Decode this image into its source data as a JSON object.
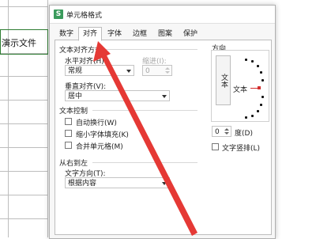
{
  "spreadsheet": {
    "cell_text": "演示文件"
  },
  "dialog": {
    "title": "单元格格式",
    "app_icon_letter": "S",
    "tabs": [
      "数字",
      "对齐",
      "字体",
      "边框",
      "图案",
      "保护"
    ],
    "active_tab": "对齐",
    "alignment": {
      "section_title": "文本对齐方式",
      "horizontal_label": "水平对齐(H):",
      "horizontal_value": "常规",
      "indent_label": "缩进(I):",
      "indent_value": "0",
      "vertical_label": "垂直对齐(V):",
      "vertical_value": "居中"
    },
    "text_control": {
      "section_title": "文本控制",
      "options": [
        {
          "label": "自动换行(W)",
          "checked": false
        },
        {
          "label": "缩小字体填充(K)",
          "checked": false
        },
        {
          "label": "合并单元格(M)",
          "checked": false
        }
      ]
    },
    "rtl": {
      "section_title": "从右到左",
      "direction_label": "文字方向(T):",
      "direction_value": "根据内容"
    },
    "orientation": {
      "section_title": "方向",
      "vertical_text": "文本",
      "dial_text": "文本",
      "degree_value": "0",
      "degree_label": "度(D)",
      "stacked_label": "文字竖排(L)",
      "stacked_checked": false
    }
  },
  "annotation": {
    "arrow_color": "#e53935"
  }
}
